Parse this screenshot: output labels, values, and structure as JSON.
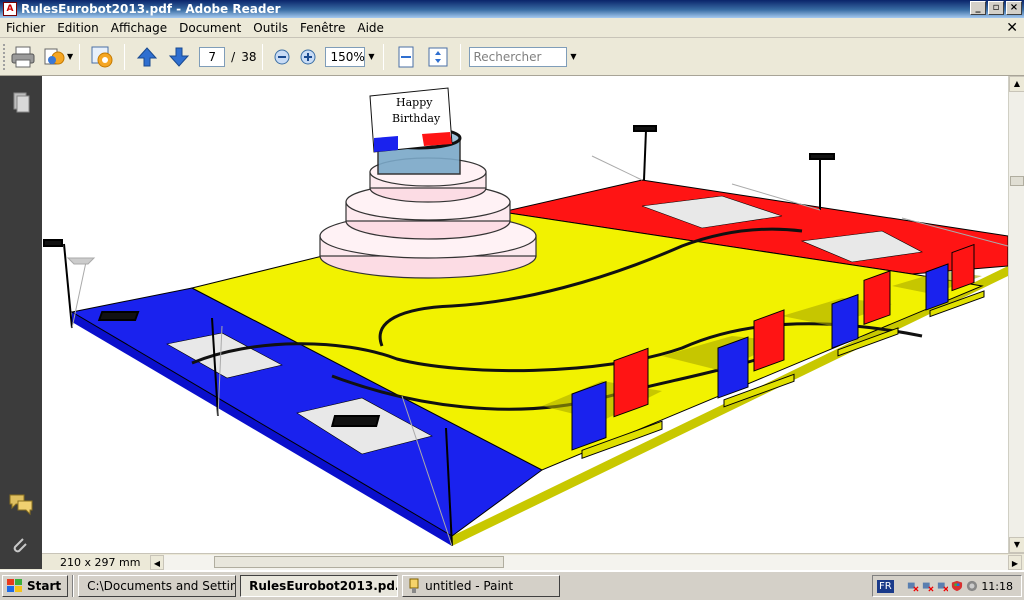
{
  "window": {
    "title": "RulesEurobot2013.pdf - Adobe Reader",
    "title_icon": "pdf-icon",
    "controls": [
      "minimize-icon",
      "maximize-icon",
      "close-icon"
    ]
  },
  "menubar": {
    "items": [
      "Fichier",
      "Edition",
      "Affichage",
      "Document",
      "Outils",
      "Fenêtre",
      "Aide"
    ],
    "close": "✕"
  },
  "toolbar": {
    "current_page": "7",
    "page_separator": "/",
    "total_pages": "38",
    "zoom": "150%",
    "search_placeholder": "Rechercher",
    "icons": [
      "print-icon",
      "share-icon",
      "collaborate-icon",
      "page-up-icon",
      "page-down-icon",
      "zoom-out-icon",
      "zoom-in-icon",
      "fit-width-icon",
      "full-screen-icon"
    ]
  },
  "document": {
    "cake_text_line1": "Happy",
    "cake_text_line2": "Birthday",
    "page_size": "210 x 297 mm"
  },
  "taskbar": {
    "start": "Start",
    "tasks": [
      {
        "label": "C:\\Documents and Settin...",
        "icon": "folder-icon"
      },
      {
        "label": "RulesEurobot2013.pd...",
        "icon": "pdf-icon"
      },
      {
        "label": "untitled - Paint",
        "icon": "paint-icon"
      }
    ],
    "language": "FR",
    "clock": "11:18"
  },
  "colors": {
    "board_yellow": "#f0f000",
    "board_blue": "#0a14e6",
    "board_red": "#f01010",
    "cake_pink": "#fde4ea"
  }
}
